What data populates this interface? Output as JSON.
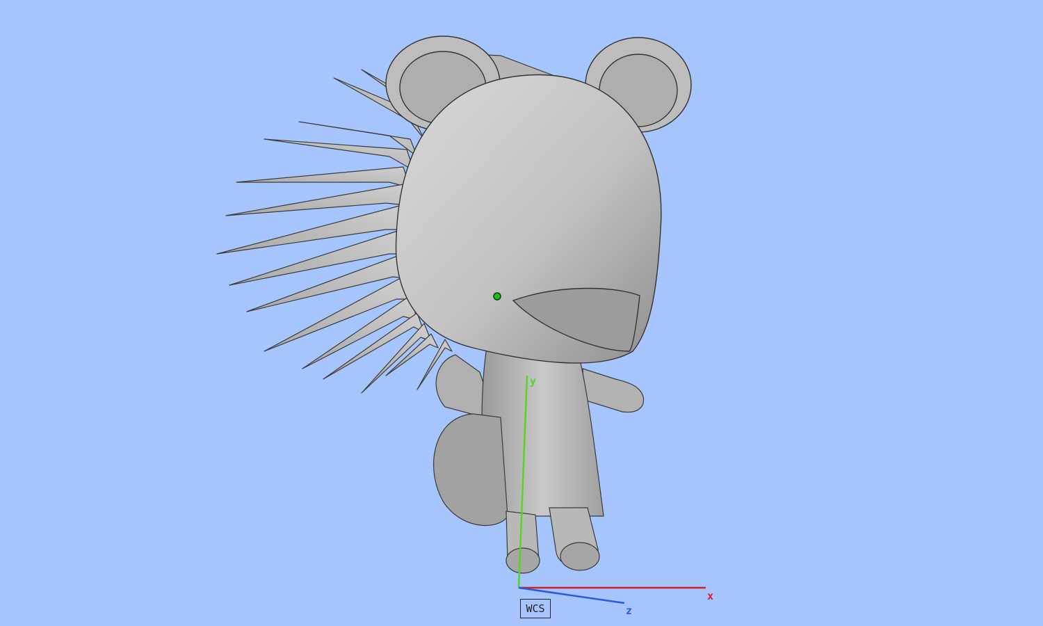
{
  "viewport": {
    "background": "#a5c5fc",
    "model": "hedgehog-figure",
    "model_color": "#c4c4c4"
  },
  "axes": {
    "x_label": "x",
    "y_label": "y",
    "z_label": "z",
    "x_color": "#d4202c",
    "y_color": "#5ad424",
    "z_color": "#2a5ae0",
    "frame_label": "WCS"
  },
  "pivot": {
    "color": "#16c016"
  }
}
